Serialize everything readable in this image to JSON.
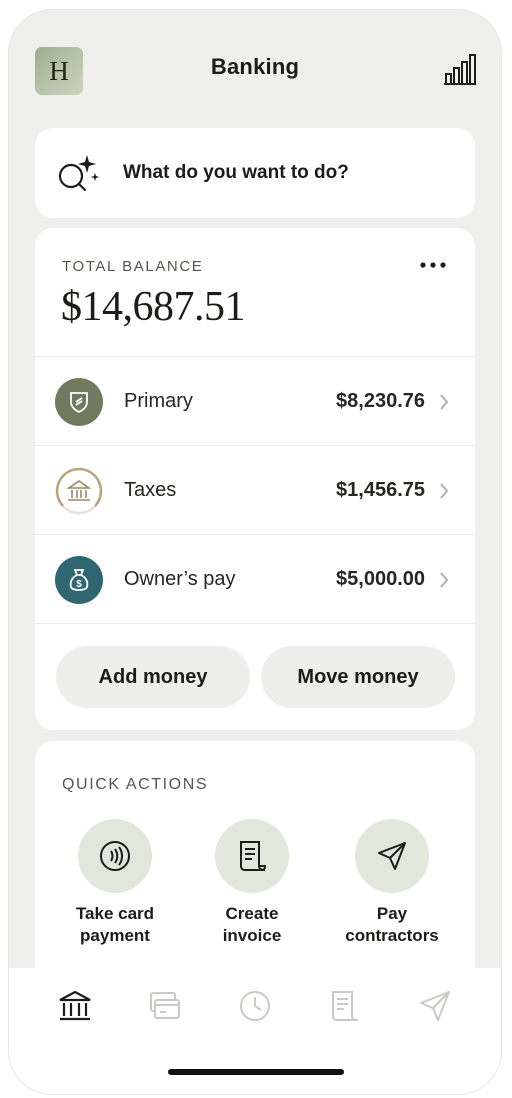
{
  "header": {
    "avatar_letter": "H",
    "title": "Banking",
    "stats_icon": "bar-chart-icon"
  },
  "search": {
    "icon": "sparkle-search-icon",
    "prompt": "What do you want to do?"
  },
  "balance": {
    "label": "TOTAL BALANCE",
    "amount": "$14,687.51",
    "accounts": [
      {
        "name": "Primary",
        "amount": "$8,230.76",
        "icon": "shield-icon",
        "color": "#707a5e"
      },
      {
        "name": "Taxes",
        "amount": "$1,456.75",
        "icon": "government-building-icon",
        "color": "#b9a67e"
      },
      {
        "name": "Owner’s pay",
        "amount": "$5,000.00",
        "icon": "money-bag-icon",
        "color": "#2f6672"
      }
    ],
    "add_money": "Add money",
    "move_money": "Move money"
  },
  "quick_actions": {
    "title": "QUICK ACTIONS",
    "items": [
      {
        "line1": "Take card",
        "line2": "payment",
        "icon": "contactless-icon"
      },
      {
        "line1": "Create",
        "line2": "invoice",
        "icon": "invoice-icon"
      },
      {
        "line1": "Pay",
        "line2": "contractors",
        "icon": "send-icon"
      }
    ]
  },
  "tabbar": {
    "tabs": [
      "bank-icon",
      "cards-icon",
      "clock-icon",
      "invoice-icon",
      "send-icon"
    ],
    "active_color": "#1c1c1a",
    "inactive_color": "#c9c9c6"
  }
}
